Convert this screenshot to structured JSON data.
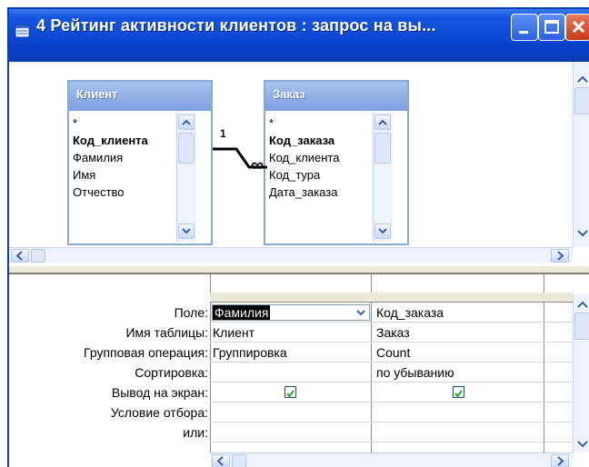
{
  "window": {
    "title": "4 Рейтинг активности клиентов : запрос на вы..."
  },
  "tables": [
    {
      "name": "Клиент",
      "fields": [
        {
          "label": "*",
          "key": false
        },
        {
          "label": "Код_клиента",
          "key": true
        },
        {
          "label": "Фамилия",
          "key": false
        },
        {
          "label": "Имя",
          "key": false
        },
        {
          "label": "Отчество",
          "key": false
        }
      ]
    },
    {
      "name": "Заказ",
      "fields": [
        {
          "label": "*",
          "key": false
        },
        {
          "label": "Код_заказа",
          "key": true
        },
        {
          "label": "Код_клиента",
          "key": false
        },
        {
          "label": "Код_тура",
          "key": false
        },
        {
          "label": "Дата_заказа",
          "key": false
        }
      ]
    }
  ],
  "relationship": {
    "one_side": "1",
    "many_side": "∞"
  },
  "grid": {
    "row_labels": [
      "Поле:",
      "Имя таблицы:",
      "Групповая операция:",
      "Сортировка:",
      "Вывод на экран:",
      "Условие отбора:",
      "или:"
    ],
    "columns": [
      {
        "field": "Фамилия",
        "table": "Клиент",
        "group": "Группировка",
        "sort": "",
        "show": true
      },
      {
        "field": "Код_заказа",
        "table": "Заказ",
        "group": "Count",
        "sort": "по убыванию",
        "show": true
      }
    ]
  },
  "colors": {
    "title_bar": "#0b47d4",
    "table_header": "#7d9fdf",
    "selection": "#000000",
    "check": "#2aa62a"
  },
  "icons": [
    "window-icon",
    "minimize-icon",
    "maximize-icon",
    "close-icon",
    "chevron-up-icon",
    "chevron-down-icon",
    "chevron-left-icon",
    "chevron-right-icon",
    "checkmark-icon",
    "dropdown-arrow-icon"
  ]
}
